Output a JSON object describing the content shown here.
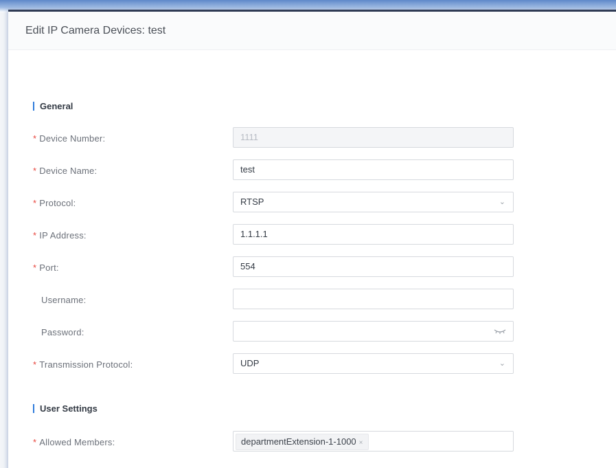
{
  "page": {
    "title": "Edit IP Camera Devices: test"
  },
  "sections": {
    "general": "General",
    "user_settings": "User Settings"
  },
  "fields": {
    "device_number": {
      "label": "Device Number",
      "value": "1111",
      "required": true,
      "disabled": true
    },
    "device_name": {
      "label": "Device Name",
      "value": "test",
      "required": true
    },
    "protocol": {
      "label": "Protocol",
      "value": "RTSP",
      "required": true
    },
    "ip_address": {
      "label": "IP Address",
      "value": "1.1.1.1",
      "required": true
    },
    "port": {
      "label": "Port",
      "value": "554",
      "required": true
    },
    "username": {
      "label": "Username",
      "value": "",
      "required": false
    },
    "password": {
      "label": "Password",
      "value": "",
      "required": false
    },
    "transmission_protocol": {
      "label": "Transmission Protocol",
      "value": "UDP",
      "required": true
    },
    "allowed_members": {
      "label": "Allowed Members",
      "required": true,
      "tags": [
        "departmentExtension-1-1000"
      ]
    }
  },
  "symbols": {
    "required_mark": "*",
    "colon": ":",
    "chevron": "⌄",
    "tag_remove": "×"
  },
  "icons": {
    "select_arrow": "chevron-down-icon",
    "password_toggle": "eye-closed-icon"
  },
  "colors": {
    "accent": "#2e7bdb",
    "required": "#e8473f",
    "header_border": "#2f3b55"
  }
}
